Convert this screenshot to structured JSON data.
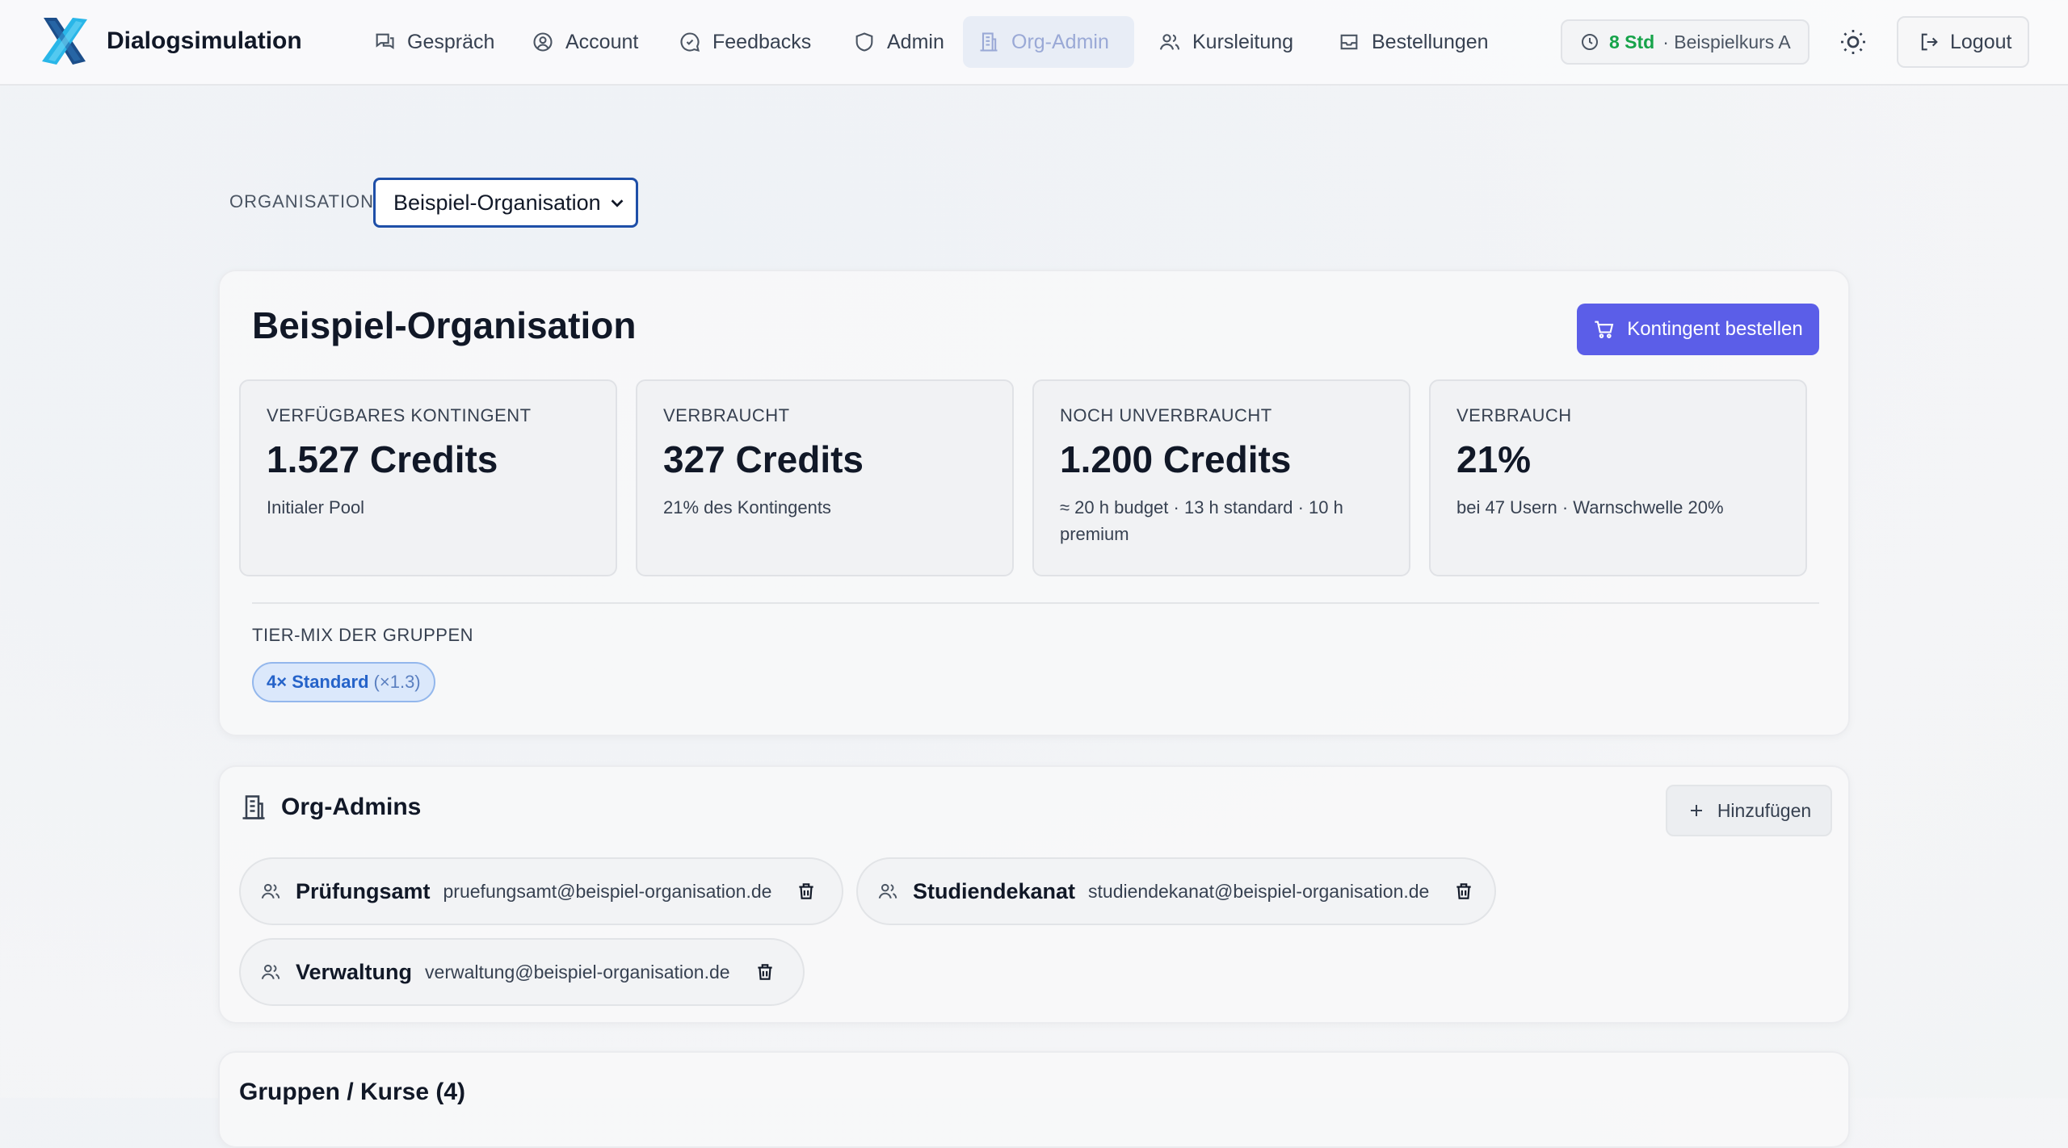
{
  "app": {
    "name": "Dialogsimulation",
    "logo_icon": "x-logo-icon"
  },
  "nav": {
    "items": [
      {
        "label": "Gespräch",
        "icon": "chat-icon"
      },
      {
        "label": "Account",
        "icon": "user-circle-icon"
      },
      {
        "label": "Feedbacks",
        "icon": "feedback-icon"
      },
      {
        "label": "Admin",
        "icon": "shield-icon"
      },
      {
        "label": "Org-Admin",
        "icon": "building-icon",
        "active": true
      },
      {
        "label": "Kursleitung",
        "icon": "users-icon"
      },
      {
        "label": "Bestellungen",
        "icon": "inbox-icon"
      }
    ],
    "quota": {
      "hours": "8 Std",
      "course": "· Beispielkurs A"
    },
    "theme_icon": "sun-icon",
    "logout": "Logout"
  },
  "org_selector": {
    "label": "ORGANISATION",
    "selected": "Beispiel-Organisation"
  },
  "org": {
    "title": "Beispiel-Organisation",
    "order_button": "Kontingent bestellen",
    "stats": [
      {
        "label": "VERFÜGBARES KONTINGENT",
        "value": "1.527 Credits",
        "sub": "Initialer Pool"
      },
      {
        "label": "VERBRAUCHT",
        "value": "327 Credits",
        "sub": "21% des Kontingents"
      },
      {
        "label": "NOCH UNVERBRAUCHT",
        "value": "1.200 Credits",
        "sub": "≈ 20 h budget · 13 h standard · 10 h premium"
      },
      {
        "label": "VERBRAUCH",
        "value": "21%",
        "sub": "bei 47 Usern · Warnschwelle 20%"
      }
    ],
    "tier_mix_label": "TIER-MIX DER GRUPPEN",
    "tier_chip": {
      "name": "4× Standard",
      "multiplier": "(×1.3)"
    }
  },
  "org_admins": {
    "title": "Org-Admins",
    "add_button": "Hinzufügen",
    "admins": [
      {
        "name": "Prüfungsamt",
        "email": "pruefungsamt@beispiel-organisation.de"
      },
      {
        "name": "Studiendekanat",
        "email": "studiendekanat@beispiel-organisation.de"
      },
      {
        "name": "Verwaltung",
        "email": "verwaltung@beispiel-organisation.de"
      }
    ]
  },
  "groups": {
    "title": "Gruppen / Kurse (4)"
  },
  "colors": {
    "accent": "#5b5ee8",
    "active_nav_bg": "#e8edf6",
    "quota_green": "#16a34a",
    "select_border": "#1e4fa8",
    "chip_blue": "#2563c9"
  }
}
